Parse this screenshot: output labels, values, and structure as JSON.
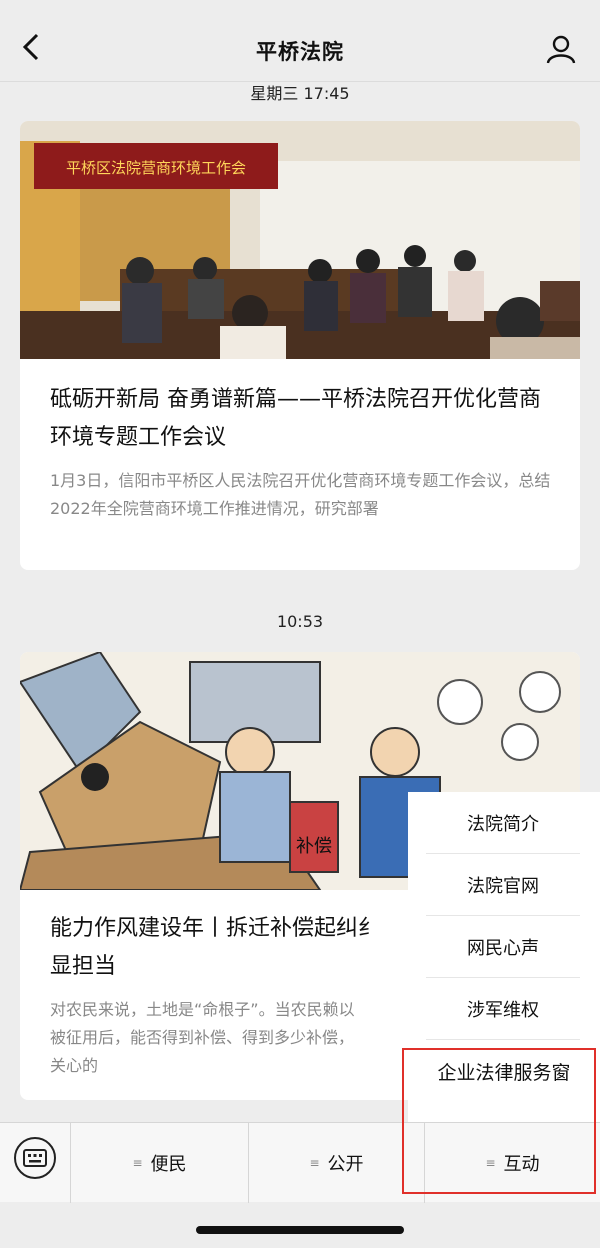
{
  "header": {
    "title": "平桥法院",
    "back_icon": "chevron-left-icon",
    "profile_icon": "person-icon"
  },
  "messages": [
    {
      "timestamp": "星期三 17:45",
      "title": "砥砺开新局 奋勇谱新篇——平桥法院召开优化营商环境专题工作会议",
      "description": "1月3日，信阳市平桥区人民法院召开优化营商环境专题工作会议，总结2022年全院营商环境工作推进情况，研究部署",
      "banner_text": "平桥区法院营商环境工作会"
    },
    {
      "timestamp": "10:53",
      "title": "能力作风建设年丨拆迁补偿起纠纷 法官调解显担当",
      "title_visible": "能力作风建设年丨拆迁补偿起纠纟",
      "title_line2": "显担当",
      "description_line1": "对农民来说，土地是“命根子”。当农民赖以",
      "description_line2": "被征用后，能否得到补偿、得到多少补偿，",
      "description_line3": "关心的",
      "sign_text": "补偿"
    }
  ],
  "menu_popup": {
    "items": [
      "法院简介",
      "法院官网",
      "网民心声",
      "涉军维权",
      "企业法律服务窗"
    ]
  },
  "bottom_bar": {
    "keyboard_icon": "keyboard-icon",
    "tabs": [
      {
        "label": "便民",
        "icon": "menu-lines-icon"
      },
      {
        "label": "公开",
        "icon": "menu-lines-icon"
      },
      {
        "label": "互动",
        "icon": "menu-lines-icon"
      }
    ]
  },
  "colors": {
    "background": "#ededed",
    "card": "#ffffff",
    "highlight": "#e0302a",
    "desc_text": "#888888"
  }
}
